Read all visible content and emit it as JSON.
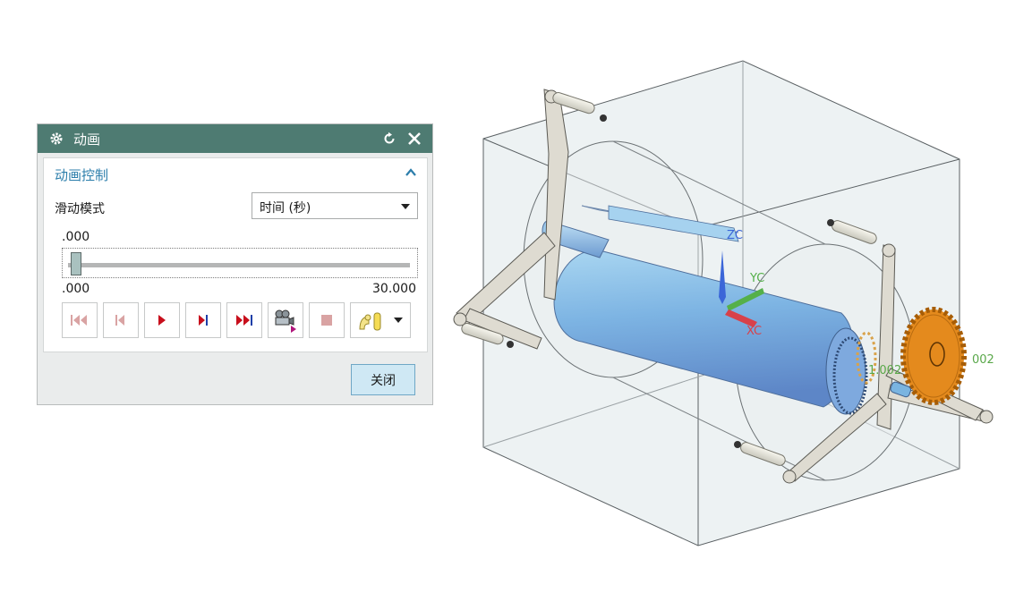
{
  "dialog": {
    "title": "动画",
    "icons": {
      "settings": "gear-icon",
      "reset": "reset-icon",
      "close": "close-icon"
    },
    "group": {
      "header": "动画控制",
      "caret": "chevron-up-icon"
    },
    "mode": {
      "label": "滑动模式",
      "selected": "时间 (秒)"
    },
    "current_value": ".000",
    "slider": {
      "min_label": ".000",
      "max_label": "30.000",
      "position": 0.0
    },
    "buttons": [
      {
        "name": "rewind-to-start-button",
        "icon": "rewind-to-start-icon",
        "enabled": false
      },
      {
        "name": "step-back-button",
        "icon": "step-back-icon",
        "enabled": false
      },
      {
        "name": "play-button",
        "icon": "play-icon",
        "enabled": true
      },
      {
        "name": "step-forward-button",
        "icon": "step-forward-icon",
        "enabled": true
      },
      {
        "name": "fast-forward-button",
        "icon": "fast-forward-icon",
        "enabled": true
      },
      {
        "name": "record-button",
        "icon": "camera-icon",
        "enabled": true
      },
      {
        "name": "stop-button",
        "icon": "stop-icon",
        "enabled": false
      },
      {
        "name": "playback-mode-button",
        "icon": "loop-mode-icon",
        "enabled": true
      }
    ],
    "close_label": "关闭"
  },
  "viewport": {
    "axes": {
      "z": "ZC",
      "y": "YC",
      "x": "XC"
    },
    "labels": {
      "mark_1": "1.002",
      "mark_2": "002"
    },
    "colors": {
      "zc": "#3b66d8",
      "yc": "#55b04a",
      "xc": "#d8414a",
      "gear": "#e48a1d",
      "label": "#5aa84a"
    }
  }
}
